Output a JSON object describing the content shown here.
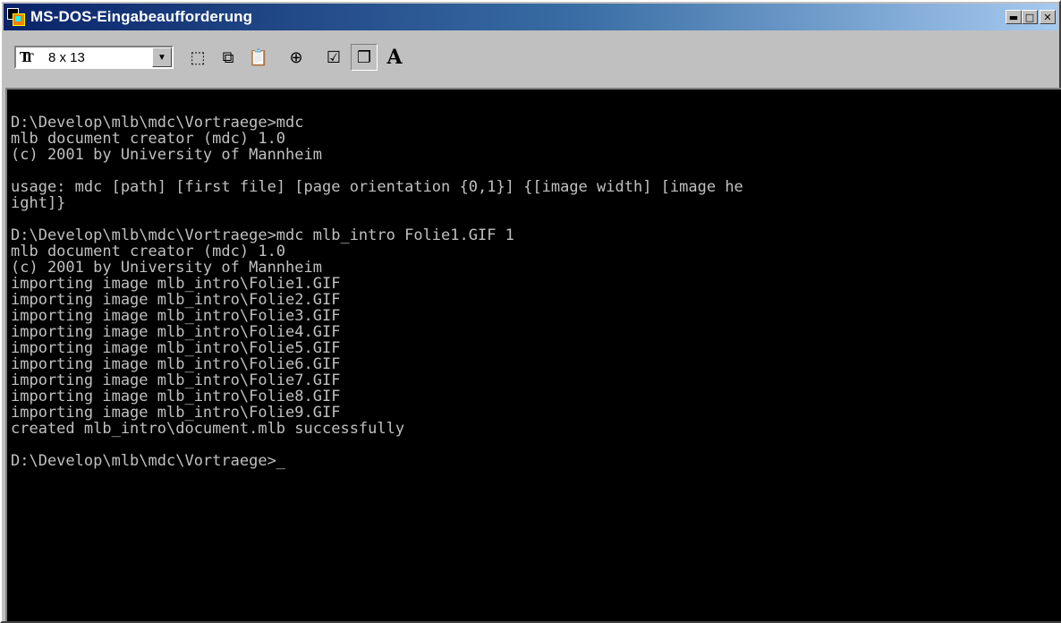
{
  "window": {
    "title": "MS-DOS-Eingabeaufforderung",
    "controls": {
      "minimize": "▬",
      "maximize": "□",
      "close": "✕"
    }
  },
  "toolbar": {
    "font_size_value": "8 x 13",
    "combo_arrow": "▼",
    "tools": [
      {
        "name": "mark-tool-icon",
        "glyph": "⬚"
      },
      {
        "name": "copy-tool-icon",
        "glyph": "⧉"
      },
      {
        "name": "paste-tool-icon",
        "glyph": "📋"
      },
      {
        "name": "fullscreen-tool-icon",
        "glyph": "⊕"
      },
      {
        "name": "properties-tool-icon",
        "glyph": "☑"
      },
      {
        "name": "background-tool-icon",
        "glyph": "❐"
      },
      {
        "name": "font-tool-icon",
        "glyph": "A"
      }
    ]
  },
  "console": {
    "lines": [
      "D:\\Develop\\mlb\\mdc\\Vortraege>mdc",
      "mlb document creator (mdc) 1.0",
      "(c) 2001 by University of Mannheim",
      "",
      "usage: mdc [path] [first file] [page orientation {0,1}] {[image width] [image he",
      "ight]}",
      "",
      "D:\\Develop\\mlb\\mdc\\Vortraege>mdc mlb_intro Folie1.GIF 1",
      "mlb document creator (mdc) 1.0",
      "(c) 2001 by University of Mannheim",
      "importing image mlb_intro\\Folie1.GIF",
      "importing image mlb_intro\\Folie2.GIF",
      "importing image mlb_intro\\Folie3.GIF",
      "importing image mlb_intro\\Folie4.GIF",
      "importing image mlb_intro\\Folie5.GIF",
      "importing image mlb_intro\\Folie6.GIF",
      "importing image mlb_intro\\Folie7.GIF",
      "importing image mlb_intro\\Folie8.GIF",
      "importing image mlb_intro\\Folie9.GIF",
      "created mlb_intro\\document.mlb successfully",
      "",
      "D:\\Develop\\mlb\\mdc\\Vortraege>_"
    ]
  }
}
